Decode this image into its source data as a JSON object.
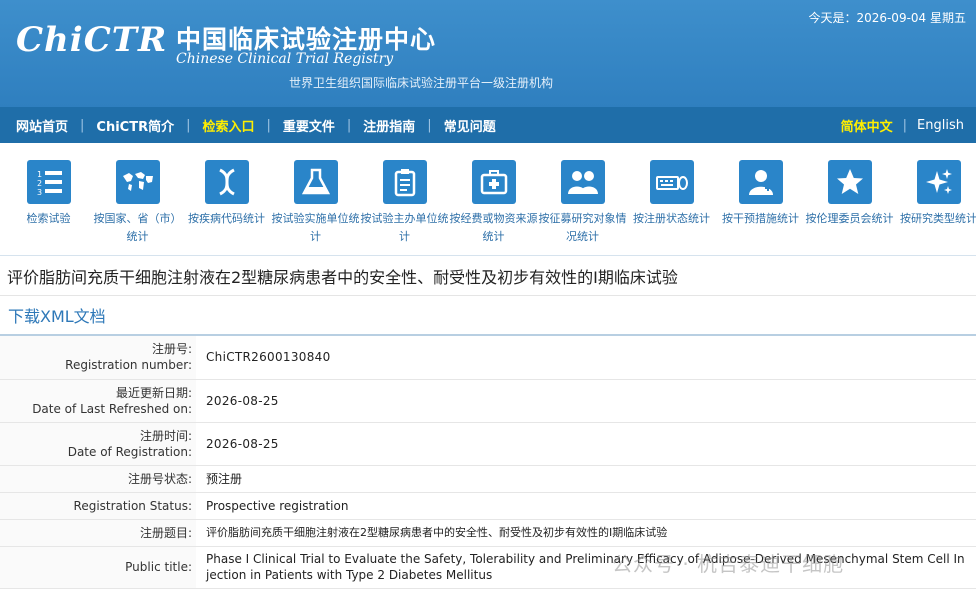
{
  "header": {
    "logo_text": "ChiCTR",
    "cn_title": "中国临床试验注册中心",
    "en_title": "Chinese Clinical Trial Registry",
    "subtitle": "世界卫生组织国际临床试验注册平台一级注册机构",
    "date": "今天是：2026-09-04 星期五"
  },
  "nav": {
    "items": [
      {
        "label": "网站首页"
      },
      {
        "label": "ChiCTR简介"
      },
      {
        "label": "检索入口"
      },
      {
        "label": "重要文件"
      },
      {
        "label": "注册指南"
      },
      {
        "label": "常见问题"
      }
    ],
    "lang_cn": "简体中文",
    "lang_en": "English"
  },
  "stat_icons": [
    {
      "label": "检索试验",
      "icon": "list-numbered-icon"
    },
    {
      "label": "按国家、省（市）统计",
      "icon": "world-map-icon"
    },
    {
      "label": "按疾病代码统计",
      "icon": "dna-icon"
    },
    {
      "label": "按试验实施单位统计",
      "icon": "flask-icon"
    },
    {
      "label": "按试验主办单位统计",
      "icon": "clipboard-icon"
    },
    {
      "label": "按经费或物资来源统计",
      "icon": "medkit-icon"
    },
    {
      "label": "按征募研究对象情况统计",
      "icon": "people-icon"
    },
    {
      "label": "按注册状态统计",
      "icon": "keyboard-mouse-icon"
    },
    {
      "label": "按干预措施统计",
      "icon": "doctor-icon"
    },
    {
      "label": "按伦理委员会统计",
      "icon": "star-icon"
    },
    {
      "label": "按研究类型统计",
      "icon": "sparkle-icon"
    }
  ],
  "trial_title": "评价脂肪间充质干细胞注射液在2型糖尿病患者中的安全性、耐受性及初步有效性的I期临床试验",
  "download_xml": "下载XML文档",
  "fields": {
    "reg_no_cn": "注册号:",
    "reg_no_en": "Registration number:",
    "reg_no": "ChiCTR2600130840",
    "last_refresh_cn": "最近更新日期:",
    "last_refresh_en": "Date of Last Refreshed on:",
    "last_refresh": "2026-08-25",
    "reg_date_cn": "注册时间:",
    "reg_date_en": "Date of Registration:",
    "reg_date": "2026-08-25",
    "status_cn_key": "注册号状态:",
    "status_cn": "预注册",
    "status_en_key": "Registration Status:",
    "status_en": "Prospective registration",
    "title_cn_key": "注册题目:",
    "title_cn": "评价脂肪间充质干细胞注射液在2型糖尿病患者中的安全性、耐受性及初步有效性的I期临床试验",
    "title_en_key": "Public title:",
    "title_en_1": "Phase I Clinical Trial to Evaluate the Safety, Tolerability and Preliminary Efficacy of Adipose-Derived Mesenchymal Stem Cell In",
    "title_en_2": "jection in Patients with Type 2 Diabetes Mellitus"
  },
  "watermark": "公众号 · 杭吉泰迪干细胞",
  "colors": {
    "header_blue": "#2f7fbf",
    "nav_blue": "#1f6ea9",
    "active_yellow": "#ffee00",
    "link_blue": "#2e78b8"
  }
}
